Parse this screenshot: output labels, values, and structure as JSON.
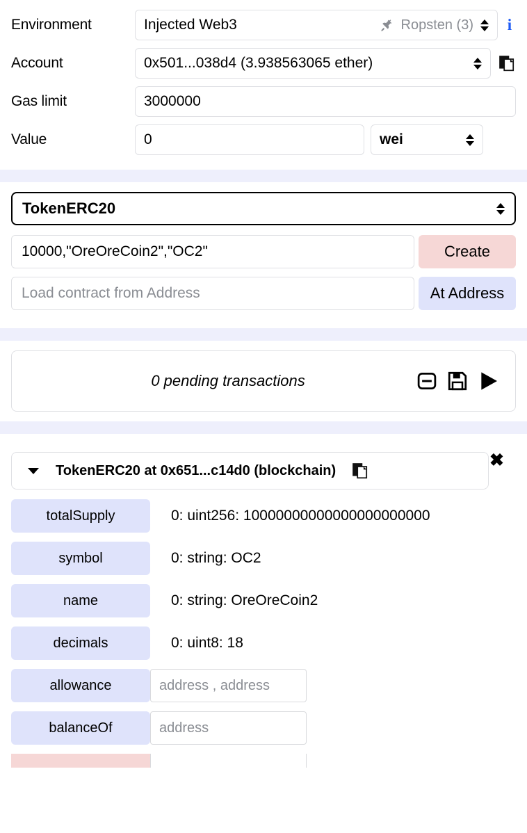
{
  "settings": {
    "rows": [
      {
        "label": "Environment",
        "value": "Injected Web3",
        "network": "Ropsten (3)",
        "icon": "plug-icon",
        "info_icon": "info-icon"
      },
      {
        "label": "Account",
        "value": "0x501...038d4 (3.938563065 ether)",
        "copy_icon": "copy-icon"
      },
      {
        "label": "Gas limit",
        "value": "3000000"
      },
      {
        "label": "Value",
        "value": "0",
        "unit": "wei"
      }
    ]
  },
  "contract": {
    "selected": "TokenERC20",
    "constructor_args": "10000,\"OreOreCoin2\",\"OC2\"",
    "create_label": "Create",
    "at_address_placeholder": "Load contract from Address",
    "at_address_value": "",
    "at_address_label": "At Address"
  },
  "pending": {
    "text": "0 pending transactions",
    "icons": [
      "minus-square-icon",
      "save-icon",
      "play-icon"
    ]
  },
  "deployed": {
    "close_label": "✖",
    "instance_title": "TokenERC20 at 0x651...c14d0 (blockchain)",
    "caret_icon": "caret-down-icon",
    "copy_icon": "copy-icon",
    "functions": [
      {
        "name": "totalSupply",
        "kind": "call",
        "output": "0: uint256: 10000000000000000000000"
      },
      {
        "name": "symbol",
        "kind": "call",
        "output": "0: string: OC2"
      },
      {
        "name": "name",
        "kind": "call",
        "output": "0: string: OreOreCoin2"
      },
      {
        "name": "decimals",
        "kind": "call",
        "output": "0: uint8: 18"
      },
      {
        "name": "allowance",
        "kind": "call",
        "input_placeholder": "address , address",
        "output": ""
      },
      {
        "name": "balanceOf",
        "kind": "call",
        "input_placeholder": "address",
        "output": ""
      },
      {
        "name": "",
        "kind": "transact",
        "input_placeholder": "",
        "output": ""
      }
    ]
  },
  "colors": {
    "call_button": "#dfe3fb",
    "transact_button": "#f6d7d6",
    "divider": "#eeeffc",
    "info_blue": "#1f5cf5",
    "muted_text": "#8a8d93"
  }
}
